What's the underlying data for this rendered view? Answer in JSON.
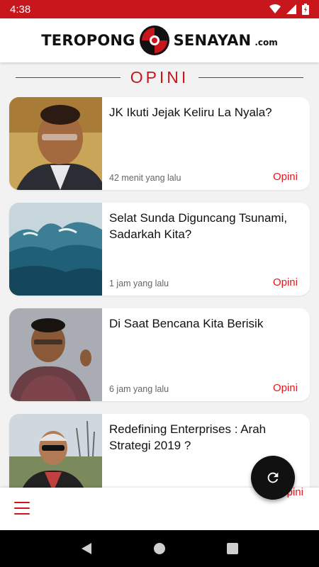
{
  "status_bar": {
    "time": "4:38",
    "icons": [
      "wifi-icon",
      "signal-icon",
      "battery-icon"
    ]
  },
  "brand": {
    "name_left": "TEROPONG",
    "name_right": "SENAYAN",
    "suffix": ".com",
    "color": "#c8161d"
  },
  "section": {
    "title": "OPINI"
  },
  "articles": [
    {
      "title": "JK Ikuti Jejak Keliru La Nyala?",
      "time": "42 menit yang lalu",
      "category": "Opini"
    },
    {
      "title": "Selat Sunda Diguncang Tsunami, Sadarkah Kita?",
      "time": "1 jam yang lalu",
      "category": "Opini"
    },
    {
      "title": "Di Saat Bencana Kita Berisik",
      "time": "6 jam yang lalu",
      "category": "Opini"
    },
    {
      "title": "Redefining Enterprises : Arah Strategi 2019 ?",
      "time": "",
      "category": ""
    }
  ],
  "bottom_bar": {
    "peek_text": "Opini",
    "menu_icon": "hamburger-menu-icon"
  },
  "fab": {
    "icon": "refresh-icon"
  },
  "nav_bar": {
    "buttons": [
      "back-icon",
      "home-icon",
      "recents-icon"
    ]
  }
}
